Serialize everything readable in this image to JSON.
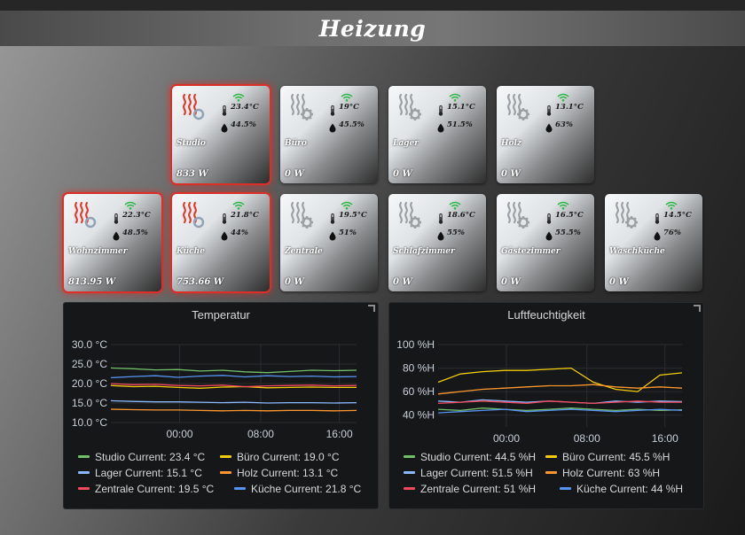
{
  "header": {
    "title": "Heizung"
  },
  "colors": {
    "active_glow": "#d9312a",
    "icon_active": "#e23b2e",
    "icon_idle": "#9aa0a3",
    "wifi": "#2fb84a"
  },
  "rooms": [
    {
      "name": "Studio",
      "temp": "23.4°C",
      "humidity": "44.5%",
      "power": "833 W",
      "active": true
    },
    {
      "name": "Büro",
      "temp": "19°C",
      "humidity": "45.5%",
      "power": "0 W",
      "active": false
    },
    {
      "name": "Lager",
      "temp": "15.1°C",
      "humidity": "51.5%",
      "power": "0 W",
      "active": false
    },
    {
      "name": "Holz",
      "temp": "13.1°C",
      "humidity": "63%",
      "power": "0 W",
      "active": false
    },
    {
      "name": "Wohnzimmer",
      "temp": "22.3°C",
      "humidity": "48.5%",
      "power": "813.95 W",
      "active": true
    },
    {
      "name": "Küche",
      "temp": "21.8°C",
      "humidity": "44%",
      "power": "753.66 W",
      "active": true
    },
    {
      "name": "Zentrale",
      "temp": "19.5°C",
      "humidity": "51%",
      "power": "0 W",
      "active": false
    },
    {
      "name": "Schlafzimmer",
      "temp": "18.6°C",
      "humidity": "55%",
      "power": "0 W",
      "active": false
    },
    {
      "name": "Gästezimmer",
      "temp": "16.5°C",
      "humidity": "55.5%",
      "power": "0 W",
      "active": false
    },
    {
      "name": "Waschküche",
      "temp": "14.5°C",
      "humidity": "76%",
      "power": "0 W",
      "active": false
    }
  ],
  "charts": {
    "temperature": {
      "title": "Temperatur",
      "y_ticks": [
        "30.0 °C",
        "25.0 °C",
        "20.0 °C",
        "15.0 °C",
        "10.0 °C"
      ],
      "x_ticks": [
        "00:00",
        "08:00",
        "16:00"
      ],
      "legend": [
        {
          "label": "Studio  Current: 23.4 °C",
          "color": "#73bf69"
        },
        {
          "label": "Büro  Current: 19.0 °C",
          "color": "#f2cc0c"
        },
        {
          "label": "Lager  Current: 15.1 °C",
          "color": "#8ab8ff"
        },
        {
          "label": "Holz  Current: 13.1 °C",
          "color": "#ff9830"
        },
        {
          "label": "Zentrale  Current: 19.5 °C",
          "color": "#f2495c"
        },
        {
          "label": "Küche  Current: 21.8 °C",
          "color": "#5794f2"
        }
      ]
    },
    "humidity": {
      "title": "Luftfeuchtigkeit",
      "y_ticks": [
        "100 %H",
        "80 %H",
        "60 %H",
        "40 %H"
      ],
      "x_ticks": [
        "00:00",
        "08:00",
        "16:00"
      ],
      "legend": [
        {
          "label": "Studio  Current: 44.5 %H",
          "color": "#73bf69"
        },
        {
          "label": "Büro  Current: 45.5 %H",
          "color": "#f2cc0c"
        },
        {
          "label": "Lager  Current: 51.5 %H",
          "color": "#8ab8ff"
        },
        {
          "label": "Holz  Current: 63 %H",
          "color": "#ff9830"
        },
        {
          "label": "Zentrale  Current: 51 %H",
          "color": "#f2495c"
        },
        {
          "label": "Küche  Current: 44 %H",
          "color": "#5794f2"
        }
      ]
    }
  },
  "chart_data": [
    {
      "type": "line",
      "title": "Temperatur",
      "ylim": [
        10,
        30
      ],
      "x_ticks": [
        "00:00",
        "08:00",
        "16:00"
      ],
      "series": [
        {
          "name": "Studio",
          "values": [
            24.0,
            23.8,
            23.5,
            23.6,
            23.2,
            23.4,
            23.0,
            22.8,
            23.1,
            23.4,
            23.3,
            23.4
          ]
        },
        {
          "name": "Büro",
          "values": [
            19.5,
            19.2,
            19.3,
            19.0,
            18.8,
            19.1,
            19.2,
            18.9,
            19.0,
            19.1,
            19.0,
            19.0
          ]
        },
        {
          "name": "Lager",
          "values": [
            15.6,
            15.4,
            15.3,
            15.3,
            15.2,
            15.1,
            15.2,
            15.0,
            15.1,
            15.1,
            15.0,
            15.1
          ]
        },
        {
          "name": "Holz",
          "values": [
            13.4,
            13.3,
            13.2,
            13.2,
            13.1,
            13.0,
            13.1,
            13.0,
            13.1,
            13.1,
            13.0,
            13.1
          ]
        },
        {
          "name": "Zentrale",
          "values": [
            20.0,
            19.7,
            19.8,
            19.5,
            19.4,
            19.6,
            19.2,
            19.4,
            19.5,
            19.6,
            19.4,
            19.5
          ]
        },
        {
          "name": "Küche",
          "values": [
            21.5,
            21.8,
            22.0,
            21.6,
            21.9,
            22.1,
            21.7,
            22.0,
            21.8,
            21.9,
            21.7,
            21.8
          ]
        }
      ]
    },
    {
      "type": "line",
      "title": "Luftfeuchtigkeit",
      "ylim": [
        30,
        100
      ],
      "x_ticks": [
        "00:00",
        "08:00",
        "16:00"
      ],
      "series": [
        {
          "name": "Studio",
          "values": [
            45,
            44,
            46,
            45,
            44,
            45,
            46,
            45,
            44,
            45,
            44,
            44.5
          ]
        },
        {
          "name": "Büro",
          "values": [
            68,
            75,
            77,
            78,
            78,
            79,
            80,
            68,
            62,
            60,
            74,
            76
          ]
        },
        {
          "name": "Lager",
          "values": [
            52,
            51,
            53,
            52,
            51,
            52,
            51,
            50,
            52,
            51,
            52,
            51.5
          ]
        },
        {
          "name": "Holz",
          "values": [
            58,
            60,
            62,
            63,
            64,
            65,
            65,
            66,
            64,
            63,
            64,
            63
          ]
        },
        {
          "name": "Zentrale",
          "values": [
            50,
            51,
            52,
            51,
            50,
            52,
            51,
            50,
            51,
            52,
            51,
            51
          ]
        },
        {
          "name": "Küche",
          "values": [
            42,
            43,
            44,
            45,
            43,
            44,
            45,
            44,
            43,
            44,
            45,
            44
          ]
        }
      ]
    }
  ]
}
